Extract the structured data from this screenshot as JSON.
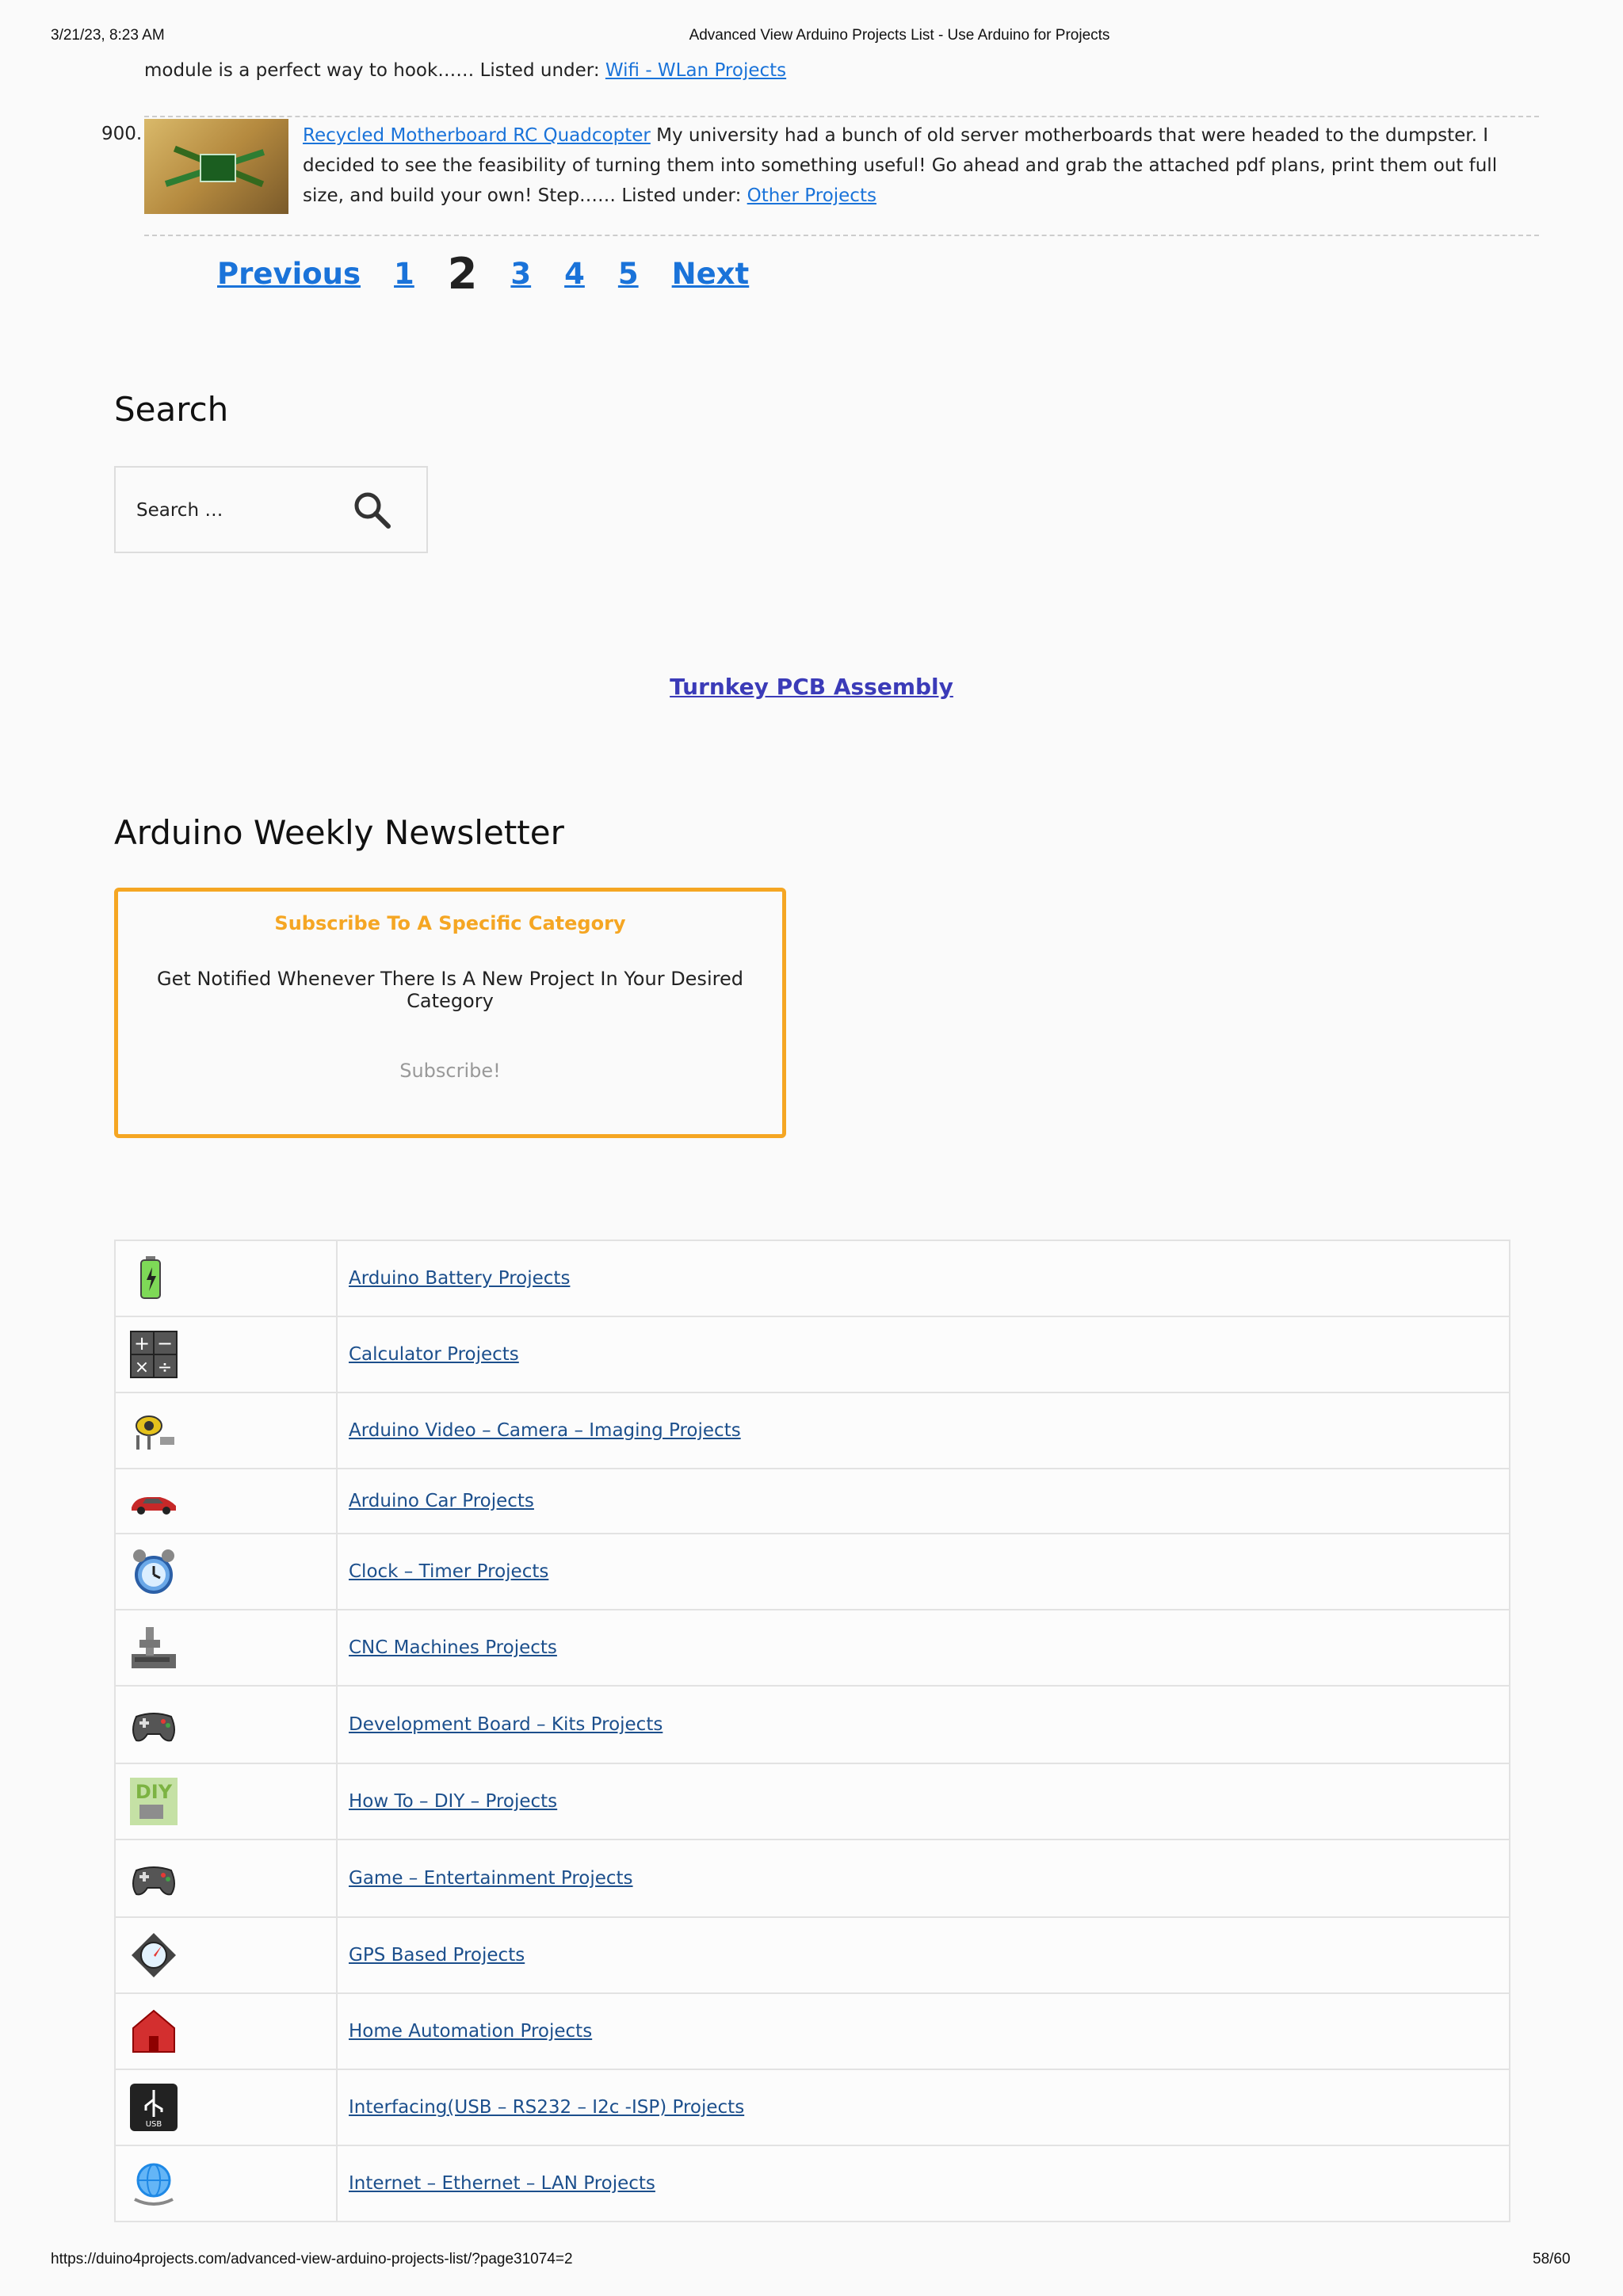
{
  "print": {
    "date": "3/21/23, 8:23 AM",
    "title": "Advanced View Arduino Projects List - Use Arduino for Projects",
    "url": "https://duino4projects.com/advanced-view-arduino-projects-list/?page31074=2",
    "page": "58/60"
  },
  "trail": {
    "text": "module is a perfect way to hook…… Listed under: ",
    "link": "Wifi - WLan Projects"
  },
  "item900": {
    "number": "900.",
    "title": "Recycled Motherboard RC Quadcopter",
    "desc": " My university had a bunch of old server motherboards that were headed to the dumpster. I decided to see the feasibility of turning them into something useful! Go ahead and grab the attached pdf plans, print them out full size, and build your own! Step…… Listed under: ",
    "category": "Other Projects"
  },
  "pager": {
    "previous": "Previous",
    "p1": "1",
    "current": "2",
    "p3": "3",
    "p4": "4",
    "p5": "5",
    "next": "Next"
  },
  "search": {
    "title": "Search",
    "placeholder": "Search …"
  },
  "pcb": {
    "label": "Turnkey PCB Assembly"
  },
  "newsletter": {
    "title": "Arduino Weekly Newsletter",
    "head": "Subscribe To A Specific Category",
    "sub": "Get Notified Whenever There Is A New Project In Your Desired Category",
    "button": "Subscribe!",
    "accent": "#f5a623"
  },
  "categories": [
    {
      "label": "Arduino Battery Projects",
      "icon": "battery-icon"
    },
    {
      "label": "Calculator Projects",
      "icon": "calculator-icon"
    },
    {
      "label": "Arduino Video – Camera – Imaging Projects",
      "icon": "camera-icon"
    },
    {
      "label": "Arduino Car Projects",
      "icon": "car-icon"
    },
    {
      "label": "Clock – Timer Projects",
      "icon": "alarm-clock-icon"
    },
    {
      "label": "CNC Machines Projects",
      "icon": "cnc-machine-icon"
    },
    {
      "label": "Development Board – Kits Projects",
      "icon": "gamepad-icon"
    },
    {
      "label": "How To – DIY – Projects",
      "icon": "diy-icon"
    },
    {
      "label": "Game – Entertainment Projects",
      "icon": "gamepad-icon"
    },
    {
      "label": "GPS Based Projects",
      "icon": "gps-compass-icon"
    },
    {
      "label": "Home Automation Projects",
      "icon": "house-icon"
    },
    {
      "label": "Interfacing(USB – RS232 – I2c -ISP) Projects",
      "icon": "usb-icon"
    },
    {
      "label": "Internet – Ethernet – LAN Projects",
      "icon": "globe-network-icon"
    }
  ]
}
